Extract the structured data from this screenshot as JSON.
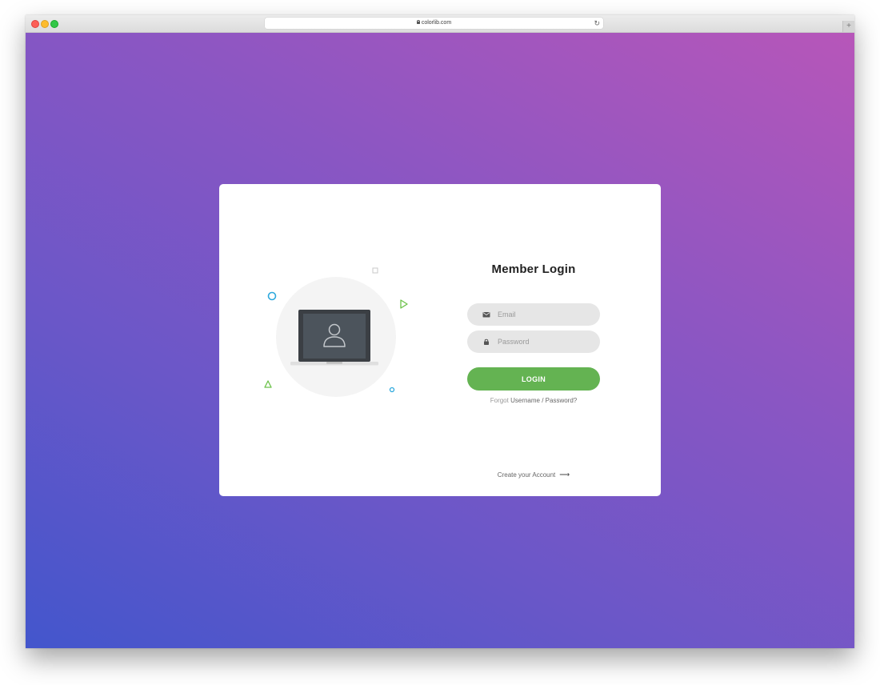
{
  "browser": {
    "url": "colorlib.com",
    "reload_icon": "reload-icon",
    "new_tab_label": "+"
  },
  "page": {
    "background_start": "#4356cc",
    "background_end": "#b756b9"
  },
  "login": {
    "title": "Member Login",
    "email_placeholder": "Email",
    "email_value": "",
    "password_placeholder": "Password",
    "password_value": "",
    "button_label": "LOGIN",
    "button_color": "#64b352",
    "forgot_prefix": "Forgot",
    "forgot_link": "Username / Password?",
    "create_account": "Create your Account",
    "create_arrow": "⟶"
  },
  "illustration": {
    "icon": "laptop-user-icon",
    "accent_blue": "#2fa9dd",
    "accent_green": "#6cc24a"
  }
}
